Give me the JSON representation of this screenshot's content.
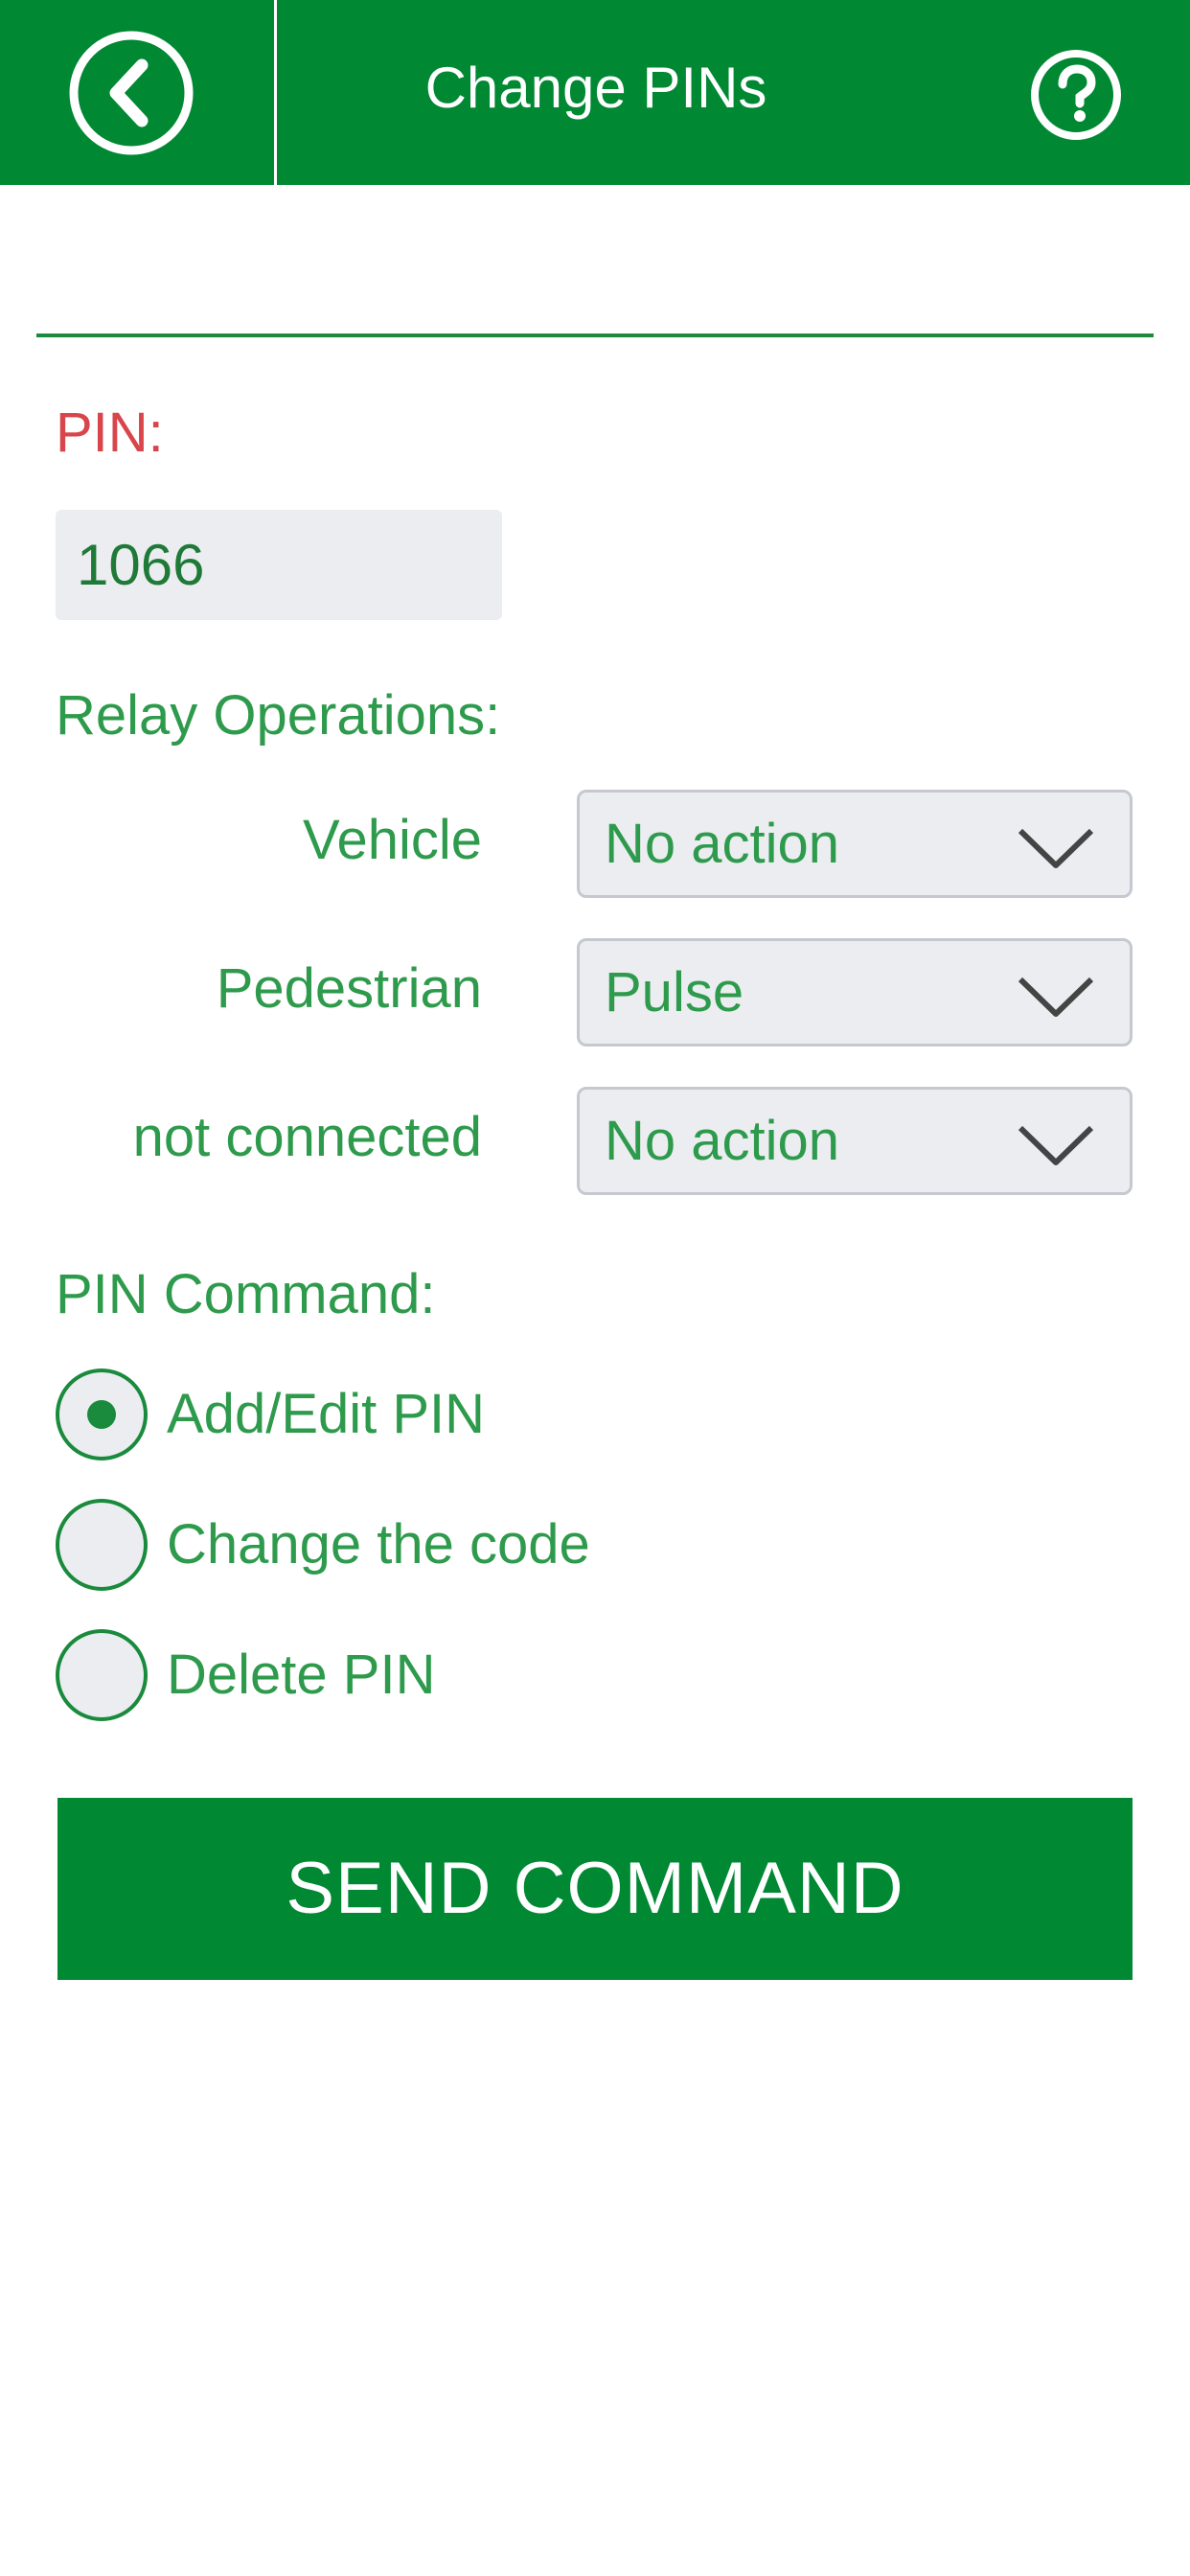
{
  "header": {
    "title": "Change PINs",
    "back_icon": "chevron-left-circle-icon",
    "help_icon": "question-circle-icon",
    "bg_color": "#008833"
  },
  "pin": {
    "label": "PIN:",
    "value": "1066"
  },
  "relay": {
    "label": "Relay Operations:",
    "rows": [
      {
        "name": "Vehicle",
        "value": "No action"
      },
      {
        "name": "Pedestrian",
        "value": "Pulse"
      },
      {
        "name": "not connected",
        "value": "No action"
      }
    ]
  },
  "command": {
    "label": "PIN Command:",
    "options": [
      {
        "label": "Add/Edit PIN",
        "selected": true
      },
      {
        "label": "Change the code",
        "selected": false
      },
      {
        "label": "Delete PIN",
        "selected": false
      }
    ]
  },
  "send_button": {
    "label": "SEND COMMAND"
  },
  "colors": {
    "accent": "#008833",
    "label_green": "#2e9a4c",
    "error_red": "#d8454a",
    "field_bg": "#ebedf1"
  }
}
